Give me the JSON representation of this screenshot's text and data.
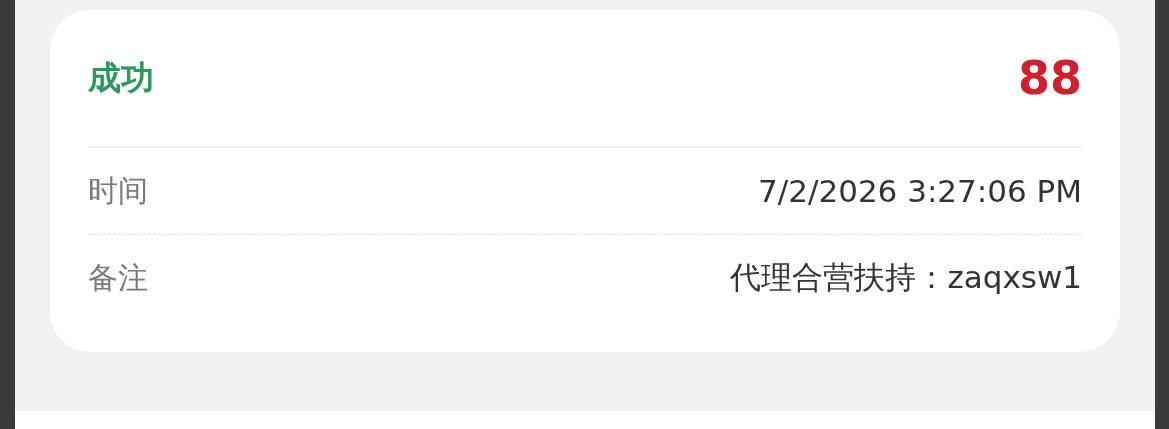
{
  "status": {
    "label": "成功",
    "kind": "success"
  },
  "amount": "88",
  "rows": [
    {
      "label": "时间",
      "value": "7/2/2026 3:27:06 PM"
    },
    {
      "label": "备注",
      "value": "代理合营扶持：zaqxsw1"
    }
  ]
}
